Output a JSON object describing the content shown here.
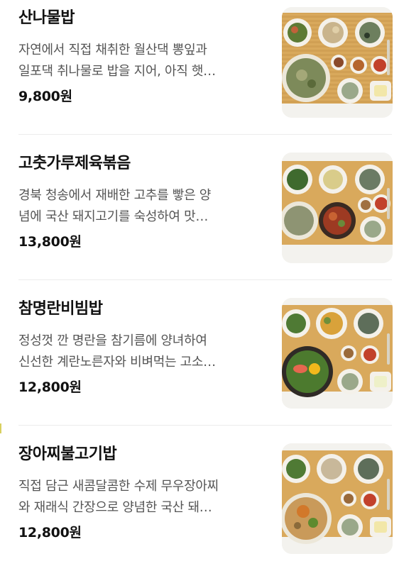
{
  "menu_items": [
    {
      "name": "산나물밥",
      "description_line1": "자연에서 직접 채취한 월산댁 뽕잎과",
      "description_line2": "일포댁 취나물로 밥을 지어, 아직 햇…",
      "price": "9,800원",
      "image_icon": "sannamul-bap-meal-photo-icon"
    },
    {
      "name": "고춧가루제육볶음",
      "description_line1": "경북 청송에서 재배한 고추를 빻은 양",
      "description_line2": "념에 국산 돼지고기를 숙성하여 맛…",
      "price": "13,800원",
      "image_icon": "jeyuk-bokkeum-meal-photo-icon"
    },
    {
      "name": "참명란비빔밥",
      "description_line1": "정성껏 깐 명란을 참기름에 양녀하여",
      "description_line2": "신선한 계란노른자와 비벼먹는 고소…",
      "price": "12,800원",
      "image_icon": "myeongran-bibimbap-meal-photo-icon"
    },
    {
      "name": "장아찌불고기밥",
      "description_line1": "직접 담근 새콤달콤한 수제 무우장아찌",
      "description_line2": "와 재래식 간장으로 양념한 국산 돼…",
      "price": "12,800원",
      "image_icon": "jangajji-bulgogi-bap-meal-photo-icon"
    }
  ],
  "colors": {
    "title": "#111111",
    "description": "#555555",
    "divider": "#ececec",
    "tray_wood": "#d9a95c",
    "bowl_white": "#f4f1ea"
  }
}
